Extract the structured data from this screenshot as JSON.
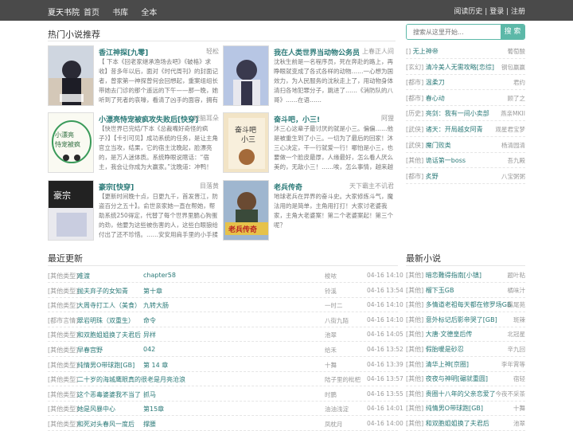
{
  "nav": {
    "brand": "夏天书院",
    "links": [
      "首页",
      "书库",
      "全本"
    ],
    "history": "阅读历史",
    "sep": " | ",
    "login": "登录",
    "register": "注册"
  },
  "hot": {
    "title": "热门小说推荐",
    "books": [
      {
        "title": "香江神探[九零]",
        "author": "轻松",
        "desc": "【 下本《回老家继承渔场去吧》《破格》求收】昔多年以后，面对《时代周刊》的封面记者，曾家第一神探曾何会回想起，重案组组长带她去门诊的那个遥远的下午——那一晚，她听到了死者的哀嚎，看清了凶手的面容，拥有了躲闪到案的……"
      },
      {
        "title": "我在人类世界当动物公务员",
        "author": "上春正人间",
        "desc": "沈秋生前是一名程序员，死在奔赴的路上，再睁眼就变成了各式各样的动物……一心想为国效力，为人民服务的沈秋走上了，用动物身体清扫各地犯罪分子，跳进了……《消防队的八哥》……在语……"
      },
      {
        "title": "小漂亮恃宠被疯攻失败后[快穿]",
        "author": "咬脑耳朵",
        "desc": "【快世界已完结/下本《总裁嘴好奇怪的疯子》】【卡引可见】成功系统的任务，是让主角官立当攻，结果，它的宿主沈晚起，脸漂亮的，是万人迷体质。系统睁眼说瞎话：“宿主，我会让你成为大赢家。”沈晚道：冲鸭！ o(≧v≦)o *"
      },
      {
        "title": "奋斗吧，小三!",
        "author": "阿狸",
        "desc": "沐三心这辈子最讨厌的就是小三。偏偏……他是被重生到了小三。一切为了最后的回家！沐三心决定，干一行就爱一行！哪怕是小三，也要做一个脸皮最厚，人缘最好，怎么看人厌么美的，无敌小三！……唉，怎么事情，越来越不对……"
      },
      {
        "title": "豪宗[快穿]",
        "author": "目落黄",
        "desc": "【更新时间晚十点，日更九千，首发晋江，防盗百分之五十】。俞世亲家她一直在帮她，帮助系统250得定，代替了每个世界里脆心狗蛋的劲，他要为这些被伤害的人，这些白眼狼给付出了还不珍惜。……安安用肩手里的小手揉了揉眼睛，发誓要……"
      },
      {
        "title": "老兵传奇",
        "author": "天下霸主不讥君",
        "desc": "地球老兵在异界的奋斗史。大家修炼斗气，魔法用的是简单，主角用打打！大家讨老婆我家，主角大老婆案！第二个老婆案起！第三个呢？"
      }
    ]
  },
  "search": {
    "placeholder": "搜索从这里开始...",
    "button": "搜 索"
  },
  "side_hot": [
    {
      "cat": "[]",
      "title": "无上神帝",
      "author": "葡萄酸"
    },
    {
      "cat": "[玄幻]",
      "title": "清冷美人无需攻略[恋综]",
      "author": "钢包赢赢"
    },
    {
      "cat": "[都市]",
      "title": "温柔刀",
      "author": "君约"
    },
    {
      "cat": "[都市]",
      "title": "春心动",
      "author": "顾了之"
    },
    {
      "cat": "[历史]",
      "title": "亮剑：我有一间小卖部",
      "author": "燕亲MKII"
    },
    {
      "cat": "[武侠]",
      "title": "诸天：开局越女阿青",
      "author": "观星君宝梦"
    },
    {
      "cat": "[武侠]",
      "title": "魔门败类",
      "author": "杨清园清"
    },
    {
      "cat": "[其他]",
      "title": "诡话第一boss",
      "author": "吾九殿"
    },
    {
      "cat": "[都市]",
      "title": "炙野",
      "author": "八宝粥粥"
    }
  ],
  "recent": {
    "title": "最近更新",
    "rows": [
      {
        "cat": "[其他类型]",
        "title": "难渡",
        "chapter": "chapter58",
        "author": "梭哝",
        "time": "04-16 14:10"
      },
      {
        "cat": "[其他类型]",
        "title": "抛夫弃子的女知青",
        "chapter": "第十章",
        "author": "铃溪",
        "time": "04-16 13:54"
      },
      {
        "cat": "[其他类型]",
        "title": "大周寺打工人（美食）",
        "chapter": "九转大肠",
        "author": "一时二",
        "time": "04-16 14:10"
      },
      {
        "cat": "[都市言情]",
        "title": "翠岩明珠（双重生）",
        "chapter": "命令",
        "author": "八街九陌",
        "time": "04-16 14:10"
      },
      {
        "cat": "[其他类型]",
        "title": "和双胞姐姐换了夫君后",
        "chapter": "异样",
        "author": "池翠",
        "time": "04-16 14:05"
      },
      {
        "cat": "[其他类型]",
        "title": "早春宫野",
        "chapter": "042",
        "author": "给禾",
        "time": "04-16 13:52"
      },
      {
        "cat": "[其他类型]",
        "title": "纯情男O带球跑[GB]",
        "chapter": "第 14 章",
        "author": "十舞",
        "time": "04-16 13:39"
      },
      {
        "cat": "[其他类型]",
        "title": "二十岁的海城鹰眼真的很老是月亮沧浪",
        "chapter": "",
        "author": "陆子里的枇杷",
        "time": "04-16 13:57"
      },
      {
        "cat": "[其他类型]",
        "title": "这个恶毒婆婆我不当了",
        "chapter": "抓马",
        "author": "时鹏",
        "time": "04-16 13:55"
      },
      {
        "cat": "[其他类型]",
        "title": "她是风暴中心",
        "chapter": "第15章",
        "author": "油油浅淀",
        "time": "04-16 14:01"
      },
      {
        "cat": "[其他类型]",
        "title": "和死对头春风一度后",
        "chapter": "撑腰",
        "author": "凤枕月",
        "time": "04-16 14:00"
      }
    ]
  },
  "latest": {
    "title": "最新小说",
    "items": [
      {
        "cat": "[其他]",
        "title": "暗恋難得指南[小镇]",
        "author": "题叶粘"
      },
      {
        "cat": "[其他]",
        "title": "榴下玉GB",
        "author": "橘味汁"
      },
      {
        "cat": "[其他]",
        "title": "多情道老祖每天都在修罗场GB",
        "author": "露尾苑"
      },
      {
        "cat": "[其他]",
        "title": "意外标记后影帝哭了[GB]",
        "author": "斑辣"
      },
      {
        "cat": "[其他]",
        "title": "大唐·文德皇后传",
        "author": "北冠星"
      },
      {
        "cat": "[其他]",
        "title": "假胎暖是砂忍",
        "author": "辛九回"
      },
      {
        "cat": "[其他]",
        "title": "清华上神[京圈]",
        "author": "李年霄等"
      },
      {
        "cat": "[其他]",
        "title": "夜夜与神明[碾就重圆]",
        "author": "宿轻"
      },
      {
        "cat": "[其他]",
        "title": "贵圈十八年的父亲恋爱了",
        "author": "今夜不采茶"
      },
      {
        "cat": "[其他]",
        "title": "纯情男O带球跑[GB]",
        "author": "十舞"
      },
      {
        "cat": "[其他]",
        "title": "和双胞姐姐换了夫君后",
        "author": "池翠"
      }
    ]
  }
}
